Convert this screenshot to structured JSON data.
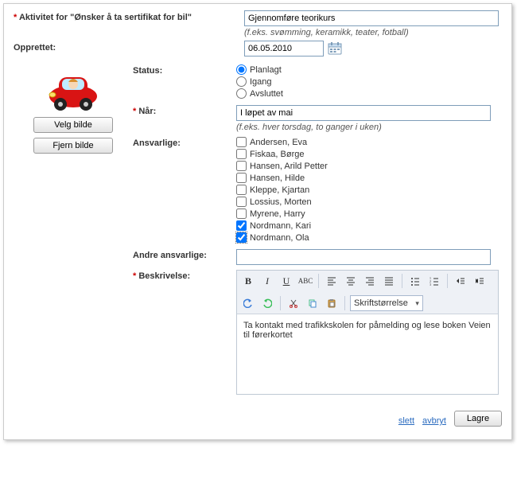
{
  "header": {
    "activity_label_prefix": "Aktivitet for \"",
    "activity_label_goal": "Ønsker å ta sertifikat for bil",
    "activity_label_suffix": "\"",
    "activity_value": "Gjennomføre teorikurs",
    "activity_hint": "(f.eks. svømming, keramikk, teater, fotball)",
    "created_label": "Opprettet:",
    "created_value": "06.05.2010"
  },
  "image_buttons": {
    "choose": "Velg bilde",
    "remove": "Fjern bilde"
  },
  "status": {
    "label": "Status:",
    "options": [
      "Planlagt",
      "Igang",
      "Avsluttet"
    ],
    "selected": "Planlagt"
  },
  "when": {
    "label": "Når:",
    "value": "I løpet av mai",
    "hint": "(f.eks. hver torsdag, to ganger i uken)"
  },
  "responsible": {
    "label": "Ansvarlige:",
    "people": [
      {
        "name": "Andersen, Eva",
        "checked": false
      },
      {
        "name": "Fiskaa, Børge",
        "checked": false
      },
      {
        "name": "Hansen, Arild Petter",
        "checked": false
      },
      {
        "name": "Hansen, Hilde",
        "checked": false
      },
      {
        "name": "Kleppe, Kjartan",
        "checked": false
      },
      {
        "name": "Lossius, Morten",
        "checked": false
      },
      {
        "name": "Myrene, Harry",
        "checked": false
      },
      {
        "name": "Nordmann, Kari",
        "checked": true
      },
      {
        "name": "Nordmann, Ola",
        "checked": true
      }
    ]
  },
  "other_responsible": {
    "label": "Andre ansvarlige:",
    "value": ""
  },
  "description": {
    "label": "Beskrivelse:",
    "text": "Ta kontakt med trafikkskolen for påmelding og lese boken Veien til førerkortet",
    "fontsize_label": "Skriftstørrelse"
  },
  "footer": {
    "delete": "slett",
    "cancel": "avbryt",
    "save": "Lagre"
  }
}
